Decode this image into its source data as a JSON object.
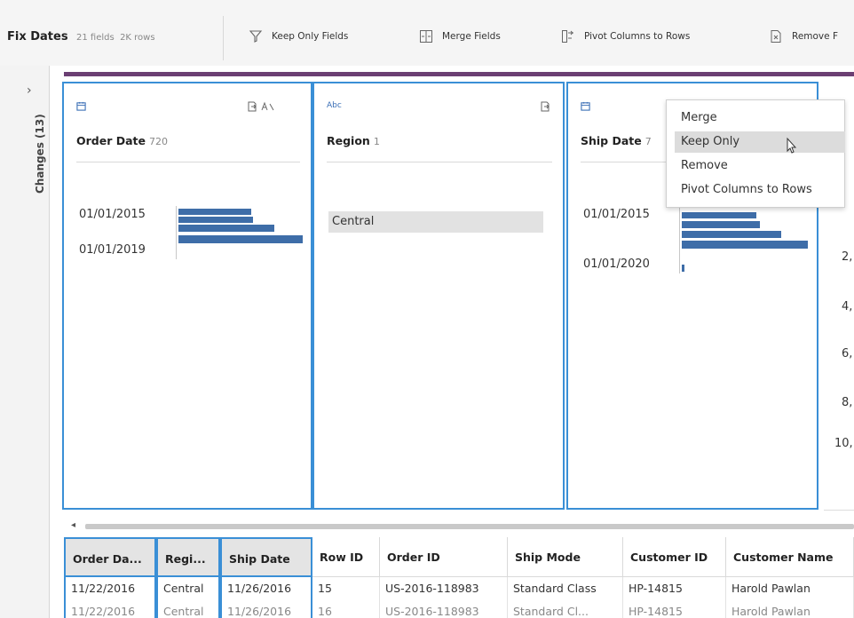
{
  "toolbar": {
    "title": "Fix Dates",
    "fields": "21 fields",
    "rows": "2K rows",
    "buttons": [
      "Keep Only Fields",
      "Merge Fields",
      "Pivot Columns to Rows",
      "Remove F"
    ]
  },
  "sidebar": {
    "expand": "›",
    "changes_label": "Changes (13)"
  },
  "cards": [
    {
      "type": "icon-calendar",
      "name": "Order Date",
      "count": "720",
      "labels": [
        "01/01/2015",
        "01/01/2019"
      ]
    },
    {
      "type": "Abc",
      "name": "Region",
      "count": "1",
      "value": "Central"
    },
    {
      "type": "icon-calendar",
      "name": "Ship Date",
      "count": "7",
      "labels": [
        "01/01/2015",
        "01/01/2020"
      ]
    }
  ],
  "right_partial_values": [
    "2,",
    "4,",
    "6,",
    "8,",
    "10,"
  ],
  "context_menu": {
    "items": [
      "Merge",
      "Keep Only",
      "Remove",
      "Pivot Columns to Rows"
    ],
    "highlighted": "Keep Only"
  },
  "grid": {
    "headers": [
      "Order Da...",
      "Regi...",
      "Ship Date",
      "Row ID",
      "Order ID",
      "Ship Mode",
      "Customer ID",
      "Customer Name"
    ],
    "row1": [
      "11/22/2016",
      "Central",
      "11/26/2016",
      "15",
      "US-2016-118983",
      "Standard Class",
      "HP-14815",
      "Harold Pawlan"
    ],
    "row2": [
      "11/22/2016",
      "Central",
      "11/26/2016",
      "16",
      "US-2016-118983",
      "Standard Cl...",
      "HP-14815",
      "Harold Pawlan"
    ]
  },
  "colors": {
    "accent": "#3a8fd6",
    "bar": "#3e6da8",
    "flow": "#6b3f73"
  }
}
